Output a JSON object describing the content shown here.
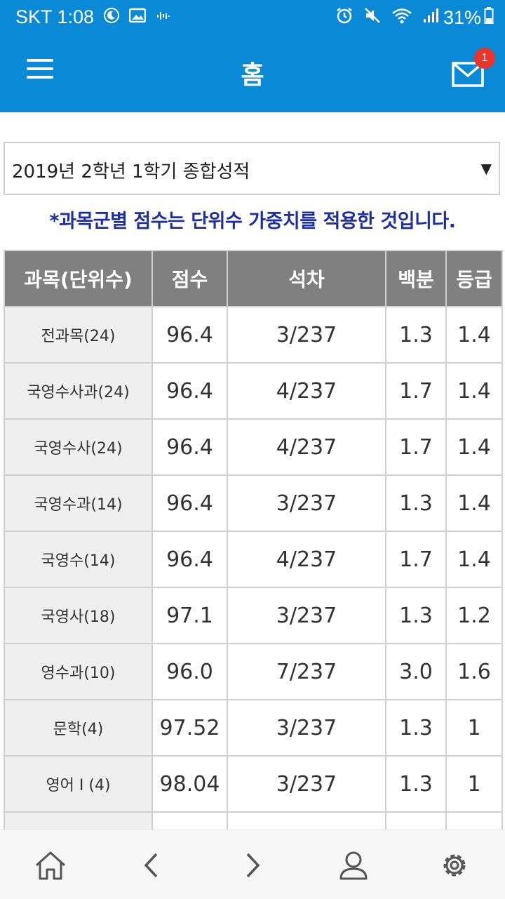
{
  "status_bar": {
    "carrier_time": "SKT 1:08",
    "battery": "31%"
  },
  "header": {
    "title": "홈",
    "mail_badge_count": "1"
  },
  "term_select": {
    "selected": "2019년 2학년 1학기 종합성적"
  },
  "notice": "*과목군별 점수는 단위수 가중치를 적용한 것입니다.",
  "table": {
    "headers": [
      "과목(단위수)",
      "점수",
      "석차",
      "백분",
      "등급"
    ],
    "rows": [
      [
        "전과목(24)",
        "96.4",
        "3/237",
        "1.3",
        "1.4"
      ],
      [
        "국영수사과(24)",
        "96.4",
        "4/237",
        "1.7",
        "1.4"
      ],
      [
        "국영수사(24)",
        "96.4",
        "4/237",
        "1.7",
        "1.4"
      ],
      [
        "국영수과(14)",
        "96.4",
        "3/237",
        "1.3",
        "1.4"
      ],
      [
        "국영수(14)",
        "96.4",
        "4/237",
        "1.7",
        "1.4"
      ],
      [
        "국영사(18)",
        "97.1",
        "3/237",
        "1.3",
        "1.2"
      ],
      [
        "영수과(10)",
        "96.0",
        "7/237",
        "3.0",
        "1.6"
      ],
      [
        "문학(4)",
        "97.52",
        "3/237",
        "1.3",
        "1"
      ],
      [
        "영어 I (4)",
        "98.04",
        "3/237",
        "1.3",
        "1"
      ],
      [
        "",
        "",
        "",
        "",
        ""
      ]
    ]
  },
  "icons": {
    "menu": "hamburger-icon",
    "mail": "mail-icon",
    "home": "home-icon",
    "back": "chevron-left-icon",
    "forward": "chevron-right-icon",
    "profile": "user-icon",
    "settings": "gear-icon"
  },
  "colors": {
    "primary": "#0a8ad6",
    "badge": "#e8342a",
    "notice": "#1d2fa3",
    "header_cell": "#808080"
  }
}
